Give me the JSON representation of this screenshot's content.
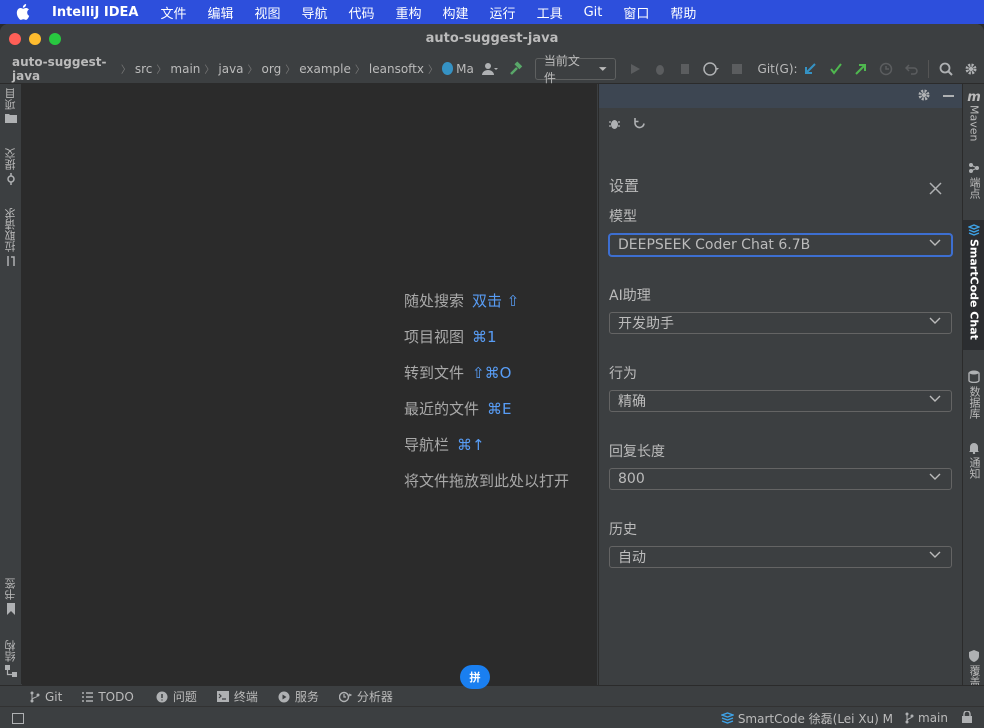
{
  "menubar": {
    "app_name": "IntelliJ IDEA",
    "items": [
      "文件",
      "编辑",
      "视图",
      "导航",
      "代码",
      "重构",
      "构建",
      "运行",
      "工具",
      "Git",
      "窗口",
      "帮助"
    ]
  },
  "window": {
    "title": "auto-suggest-java"
  },
  "breadcrumbs": [
    "auto-suggest-java",
    "src",
    "main",
    "java",
    "org",
    "example",
    "leansoftx"
  ],
  "breadcrumb_file": "Ma",
  "toolbar": {
    "run_config": "当前文件",
    "git_label": "Git(G):"
  },
  "left_stripe": {
    "tabs": [
      "项目",
      "提交",
      "拉取请求",
      "书签",
      "结构"
    ]
  },
  "editor_hints": [
    {
      "text": "随处搜索",
      "key": "双击 ⇧"
    },
    {
      "text": "项目视图",
      "key": "⌘1"
    },
    {
      "text": "转到文件",
      "key": "⇧⌘O"
    },
    {
      "text": "最近的文件",
      "key": "⌘E"
    },
    {
      "text": "导航栏",
      "key": "⌘↑"
    },
    {
      "text": "将文件拖放到此处以打开",
      "key": ""
    }
  ],
  "settings_panel": {
    "title": "设置",
    "fields": [
      {
        "label": "模型",
        "value": "DEEPSEEK Coder Chat 6.7B"
      },
      {
        "label": "AI助理",
        "value": "开发助手"
      },
      {
        "label": "行为",
        "value": "精确"
      },
      {
        "label": "回复长度",
        "value": "800"
      },
      {
        "label": "历史",
        "value": "自动"
      }
    ]
  },
  "right_stripe": {
    "tabs": [
      "Maven",
      "端点",
      "SmartCode Chat",
      "数据库",
      "通知",
      "覆盖率"
    ]
  },
  "bottom_tabs": [
    "Git",
    "TODO",
    "问题",
    "终端",
    "服务",
    "分析器"
  ],
  "ime_label": "拼",
  "status_bar": {
    "plugin": "SmartCode 徐磊(Lei Xu) M",
    "branch": "main"
  },
  "colors": {
    "menubar_bg": "#2d4fdc",
    "accent_blue": "#589df6",
    "git_green": "#4fb84f",
    "focus_border": "#3d6fd1"
  }
}
